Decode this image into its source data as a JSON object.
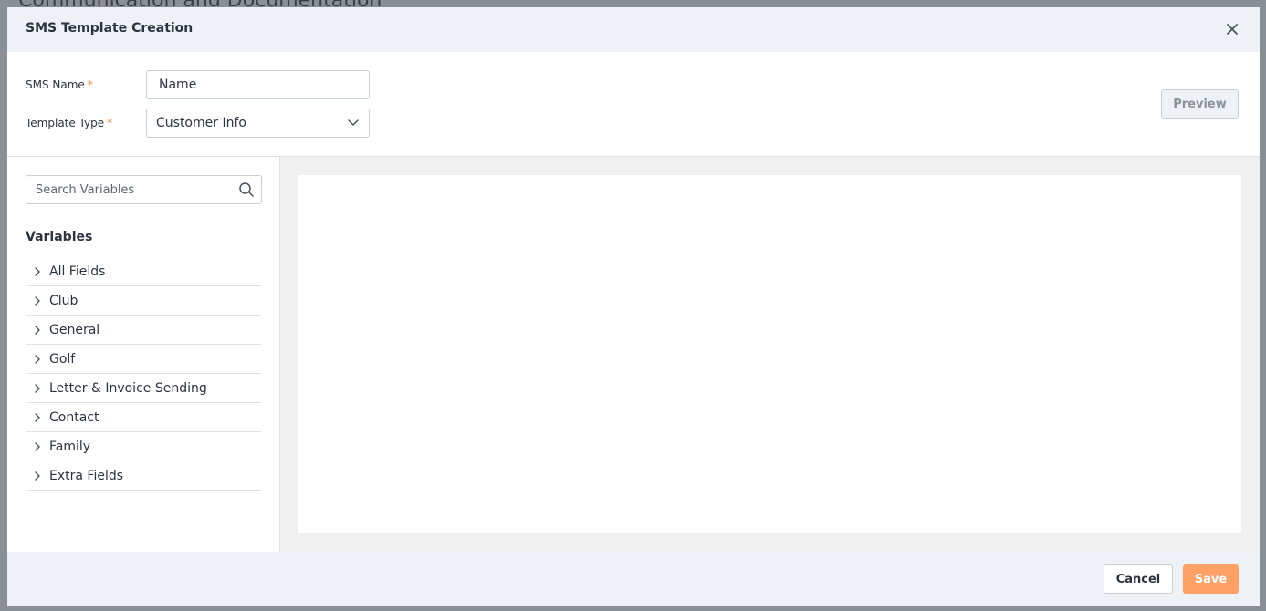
{
  "backdrop": {
    "title": "Communication and Documentation"
  },
  "modal": {
    "title": "SMS Template Creation",
    "close_icon": "close-icon"
  },
  "form": {
    "sms_name_label": "SMS Name",
    "required_marker": "*",
    "sms_name_value": "Name",
    "template_type_label": "Template Type",
    "template_type_value": "Customer Info",
    "preview_label": "Preview"
  },
  "sidebar": {
    "search_placeholder": "Search Variables",
    "variables_heading": "Variables",
    "items": [
      {
        "label": "All Fields"
      },
      {
        "label": "Club"
      },
      {
        "label": "General"
      },
      {
        "label": "Golf"
      },
      {
        "label": "Letter & Invoice Sending"
      },
      {
        "label": "Contact"
      },
      {
        "label": "Family"
      },
      {
        "label": "Extra Fields"
      }
    ]
  },
  "footer": {
    "cancel_label": "Cancel",
    "save_label": "Save"
  },
  "colors": {
    "accent": "#ffa066",
    "required": "#f0883e",
    "header_bg": "#eef2f6"
  }
}
